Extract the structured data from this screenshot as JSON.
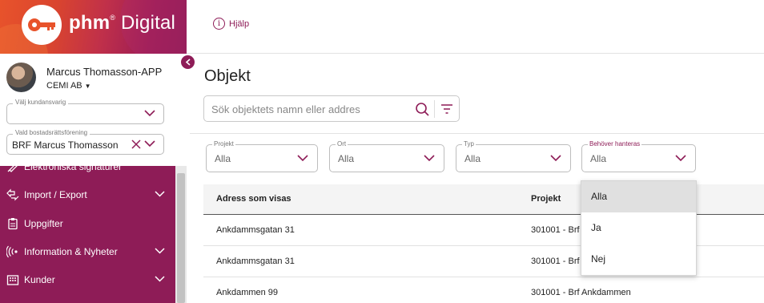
{
  "colors": {
    "brand": "#8e1c57",
    "brand_gradient_start": "#e8532b"
  },
  "brand": {
    "name_bold": "phm",
    "name_mark": "®",
    "name_light": " Digital"
  },
  "user": {
    "name": "Marcus Thomasson-APP",
    "org": "CEMI AB"
  },
  "customer_select": {
    "legend": "Välj kundansvarig",
    "value": ""
  },
  "association_select": {
    "legend": "Vald bostadsrättsförening",
    "value": "BRF Marcus Thomasson"
  },
  "menu": {
    "items": [
      {
        "label": "Elektroniska signaturer",
        "icon": "signature-icon",
        "has_children": false
      },
      {
        "label": "Import / Export",
        "icon": "import-export-icon",
        "has_children": true
      },
      {
        "label": "Uppgifter",
        "icon": "clipboard-icon",
        "has_children": false
      },
      {
        "label": "Information & Nyheter",
        "icon": "broadcast-icon",
        "has_children": true
      },
      {
        "label": "Kunder",
        "icon": "building-icon",
        "has_children": true
      }
    ]
  },
  "topbar": {
    "help_label": "Hjälp"
  },
  "page": {
    "title": "Objekt"
  },
  "search": {
    "placeholder": "Sök objektets namn eller addres",
    "value": ""
  },
  "filters": [
    {
      "legend": "Projekt",
      "value": "Alla"
    },
    {
      "legend": "Ort",
      "value": "Alla"
    },
    {
      "legend": "Typ",
      "value": "Alla"
    },
    {
      "legend": "Behöver hanteras",
      "value": "Alla"
    }
  ],
  "table": {
    "headers": [
      "Adress som visas",
      "Projekt"
    ],
    "rows": [
      [
        "Ankdammsgatan 31",
        "301001 - Brf"
      ],
      [
        "Ankdammsgatan 31",
        "301001 - Brf"
      ],
      [
        "Ankdammen 99",
        "301001 - Brf Ankdammen"
      ]
    ]
  },
  "dropdown": {
    "options": [
      "Alla",
      "Ja",
      "Nej"
    ],
    "selected": "Alla"
  }
}
